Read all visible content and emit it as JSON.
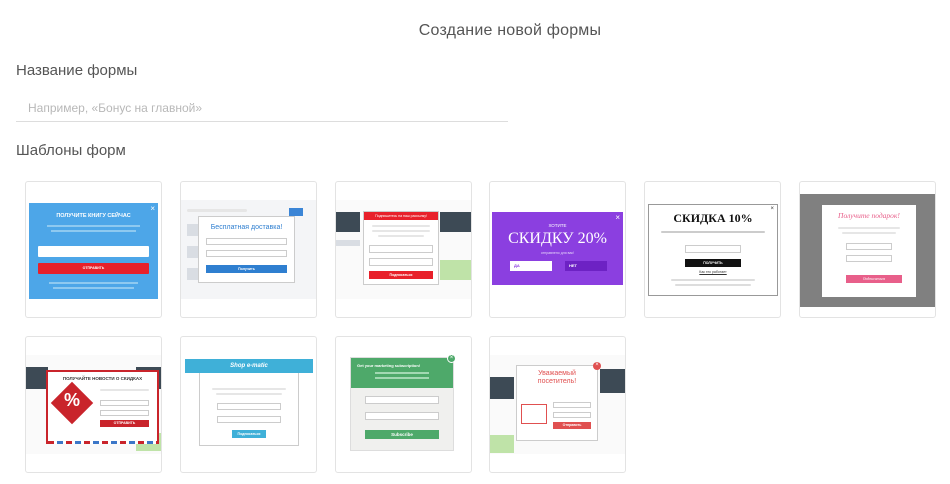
{
  "page": {
    "title": "Создание новой формы"
  },
  "form_name": {
    "label": "Название формы",
    "placeholder": "Например, «Бонус на главной»",
    "value": ""
  },
  "templates": {
    "label": "Шаблоны форм",
    "t1": {
      "title": "ПОЛУЧИТЕ КНИГУ СЕЙЧАС",
      "button": "ОТПРАВИТЬ",
      "accent": "#4da6e8",
      "btn_color": "#e8202a"
    },
    "t2": {
      "title": "Бесплатная доставка!",
      "button": "Получить",
      "accent": "#2f7fd0"
    },
    "t3": {
      "title": "Подпишитесь на наш рассылку!",
      "button": "Подписаться",
      "accent": "#e8202a"
    },
    "t4": {
      "top": "ХОТИТЕ",
      "title": "СКИДКУ 20%",
      "sub": "отправлено для вас!",
      "yes": "ДА",
      "no": "НЕТ",
      "accent": "#8b3fe0"
    },
    "t5": {
      "title": "СКИДКА 10%",
      "button": "ПОЛУЧИТЬ",
      "link": "Как это работает"
    },
    "t6": {
      "title": "Получите подарок!",
      "button": "Подписаться",
      "accent": "#e85f8a"
    },
    "t7": {
      "title": "ПОЛУЧАЙТЕ НОВОСТИ О СКИДКАХ",
      "button": "ОТПРАВИТЬ",
      "badge": "%",
      "accent": "#c9242b"
    },
    "t8": {
      "title": "Shop e-matic",
      "button": "Подписаться",
      "accent": "#3fb0d8"
    },
    "t9": {
      "title": "Get your marketing subscription!",
      "button": "Subscribe",
      "accent": "#4ea96a"
    },
    "t10": {
      "title": "Уважаемый посетитель!",
      "button": "Отправить",
      "accent": "#e05050"
    }
  }
}
